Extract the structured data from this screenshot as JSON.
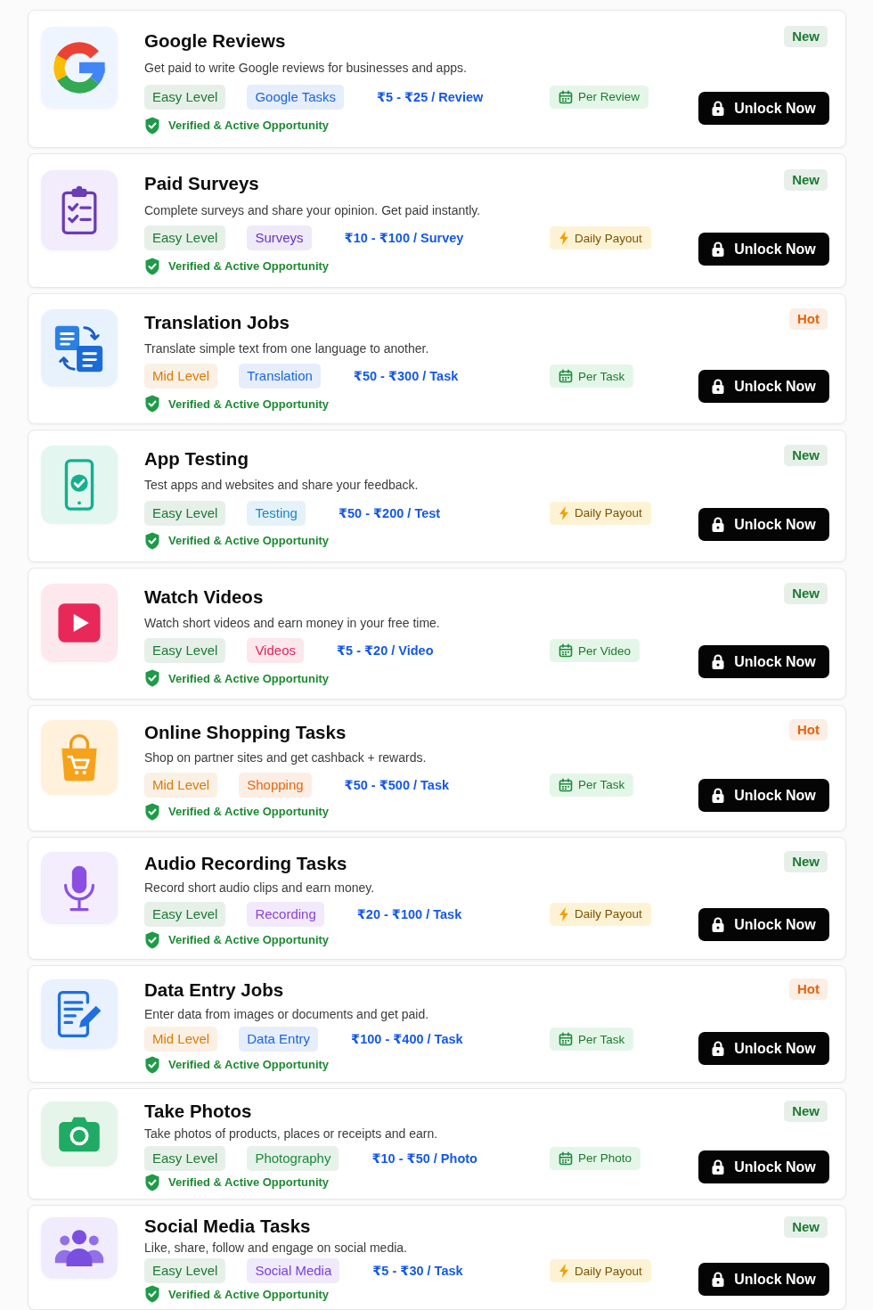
{
  "cards": [
    {
      "title": "Google Reviews",
      "description": "Get paid to write Google reviews for businesses and apps.",
      "level": {
        "label": "Easy Level",
        "color": "#1e7a33"
      },
      "category": {
        "label": "Google Tasks",
        "color": "#1a66e0"
      },
      "price": "₹5 - ₹25 / Review",
      "payout": {
        "label": "Per Review",
        "kind": "unit"
      },
      "verified": "Verified & Active Opportunity",
      "status": {
        "label": "New",
        "color": "#1e7a33"
      },
      "button": "Unlock Now"
    },
    {
      "title": "Paid Surveys",
      "description": "Complete surveys and share your opinion. Get paid instantly.",
      "level": {
        "label": "Easy Level",
        "color": "#1e7a33"
      },
      "category": {
        "label": "Surveys",
        "color": "#6a33c2"
      },
      "price": "₹10 - ₹100 / Survey",
      "payout": {
        "label": "Daily Payout",
        "kind": "daily"
      },
      "verified": "Verified & Active Opportunity",
      "status": {
        "label": "New",
        "color": "#1e7a33"
      },
      "button": "Unlock Now"
    },
    {
      "title": "Translation Jobs",
      "description": "Translate simple text from one language to another.",
      "level": {
        "label": "Mid Level",
        "color": "#d97b06"
      },
      "category": {
        "label": "Translation",
        "color": "#1a66e0"
      },
      "price": "₹50 - ₹300 / Task",
      "payout": {
        "label": "Per Task",
        "kind": "unit"
      },
      "verified": "Verified & Active Opportunity",
      "status": {
        "label": "Hot",
        "color": "#e8620c"
      },
      "button": "Unlock Now"
    },
    {
      "title": "App Testing",
      "description": "Test apps and websites and share your feedback.",
      "level": {
        "label": "Easy Level",
        "color": "#1e7a33"
      },
      "category": {
        "label": "Testing",
        "color": "#1b88c4"
      },
      "price": "₹50 - ₹200 / Test",
      "payout": {
        "label": "Daily Payout",
        "kind": "daily"
      },
      "verified": "Verified & Active Opportunity",
      "status": {
        "label": "New",
        "color": "#1e7a33"
      },
      "button": "Unlock Now"
    },
    {
      "title": "Watch Videos",
      "description": "Watch short videos and earn money in your free time.",
      "level": {
        "label": "Easy Level",
        "color": "#1e7a33"
      },
      "category": {
        "label": "Videos",
        "color": "#e0245a"
      },
      "price": "₹5 - ₹20 / Video",
      "payout": {
        "label": "Per Video",
        "kind": "unit"
      },
      "verified": "Verified & Active Opportunity",
      "status": {
        "label": "New",
        "color": "#1e7a33"
      },
      "button": "Unlock Now"
    },
    {
      "title": "Online Shopping Tasks",
      "description": "Shop on partner sites and get cashback + rewards.",
      "level": {
        "label": "Mid Level",
        "color": "#d97b06"
      },
      "category": {
        "label": "Shopping",
        "color": "#e8650f"
      },
      "price": "₹50 - ₹500 / Task",
      "payout": {
        "label": "Per Task",
        "kind": "unit"
      },
      "verified": "Verified & Active Opportunity",
      "status": {
        "label": "Hot",
        "color": "#e8620c"
      },
      "button": "Unlock Now"
    },
    {
      "title": "Audio Recording Tasks",
      "description": "Record short audio clips and earn money.",
      "level": {
        "label": "Easy Level",
        "color": "#1e7a33"
      },
      "category": {
        "label": "Recording",
        "color": "#8a44d6"
      },
      "price": "₹20 - ₹100 / Task",
      "payout": {
        "label": "Daily Payout",
        "kind": "daily"
      },
      "verified": "Verified & Active Opportunity",
      "status": {
        "label": "New",
        "color": "#1e7a33"
      },
      "button": "Unlock Now"
    },
    {
      "title": "Data Entry Jobs",
      "description": "Enter data from images or documents and get paid.",
      "level": {
        "label": "Mid Level",
        "color": "#d97b06"
      },
      "category": {
        "label": "Data Entry",
        "color": "#1a66e0"
      },
      "price": "₹100 - ₹400 / Task",
      "payout": {
        "label": "Per Task",
        "kind": "unit"
      },
      "verified": "Verified & Active Opportunity",
      "status": {
        "label": "Hot",
        "color": "#e8620c"
      },
      "button": "Unlock Now"
    },
    {
      "title": "Take Photos",
      "description": "Take photos of products, places or receipts and earn.",
      "level": {
        "label": "Easy Level",
        "color": "#1e7a33"
      },
      "category": {
        "label": "Photography",
        "color": "#1e8a3e"
      },
      "price": "₹10 - ₹50 / Photo",
      "payout": {
        "label": "Per Photo",
        "kind": "unit"
      },
      "verified": "Verified & Active Opportunity",
      "status": {
        "label": "New",
        "color": "#1e7a33"
      },
      "button": "Unlock Now"
    },
    {
      "title": "Social Media Tasks",
      "description": "Like, share, follow and engage on social media.",
      "level": {
        "label": "Easy Level",
        "color": "#1e7a33"
      },
      "category": {
        "label": "Social Media",
        "color": "#7a3fd6"
      },
      "price": "₹5 - ₹30 / Task",
      "payout": {
        "label": "Daily Payout",
        "kind": "daily"
      },
      "verified": "Verified & Active Opportunity",
      "status": {
        "label": "New",
        "color": "#1e7a33"
      },
      "button": "Unlock Now"
    }
  ]
}
